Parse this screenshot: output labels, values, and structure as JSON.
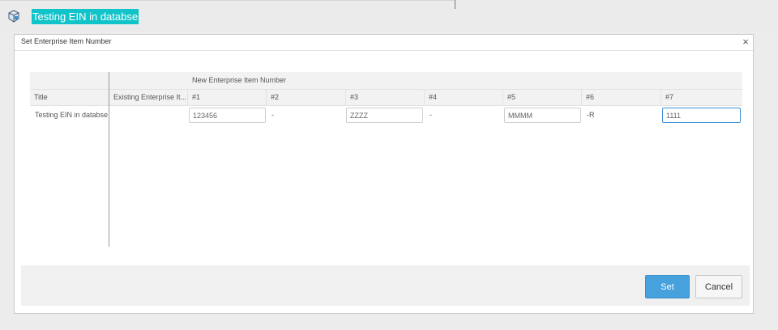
{
  "item": {
    "title": "Testing EIN in databse",
    "icon": "part-cube-icon"
  },
  "dialog": {
    "title": "Set Enterprise Item Number",
    "close_glyph": "×"
  },
  "table": {
    "group_header": "New Enterprise Item Number",
    "columns": [
      "Title",
      "Existing Enterprise It...",
      "#1",
      "#2",
      "#3",
      "#4",
      "#5",
      "#6",
      "#7"
    ],
    "row": {
      "title": "Testing EIN in databse",
      "existing": "",
      "seg1": "123456",
      "seg2": "-",
      "seg3": "ZZZZ",
      "seg4": "-",
      "seg5": "MMMM",
      "seg6": "-R",
      "seg7": "1111"
    }
  },
  "buttons": {
    "set": "Set",
    "cancel": "Cancel"
  },
  "colors": {
    "accent": "#47a1dc",
    "highlight": "#11c4c9",
    "focus_border": "#3a8fd8"
  }
}
